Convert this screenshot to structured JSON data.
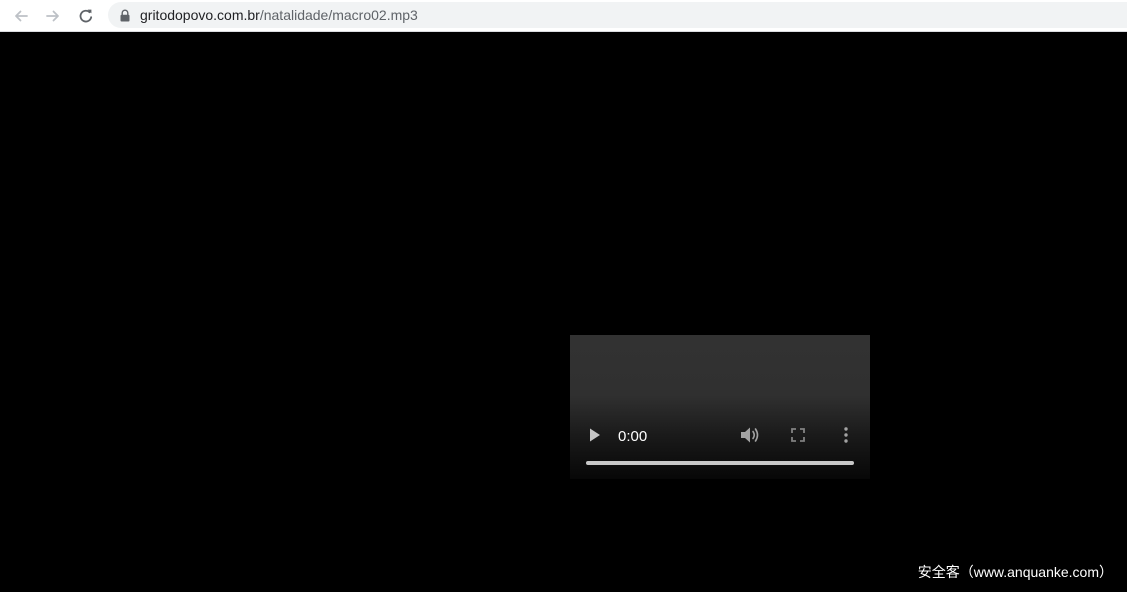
{
  "browser": {
    "url_host": "gritodopovo.com.br",
    "url_path": "/natalidade/macro02.mp3"
  },
  "media_player": {
    "current_time": "0:00",
    "progress_fraction": 0
  },
  "watermark": {
    "text": "安全客（www.anquanke.com）"
  },
  "icons": {
    "back": "arrow-left-icon",
    "forward": "arrow-right-icon",
    "reload": "reload-icon",
    "lock": "lock-icon",
    "play": "play-icon",
    "volume": "volume-icon",
    "fullscreen": "fullscreen-icon",
    "more": "more-vertical-icon"
  },
  "colors": {
    "page_background": "#000000",
    "omnibox_background": "#f1f3f4",
    "player_control": "#ffffff"
  }
}
